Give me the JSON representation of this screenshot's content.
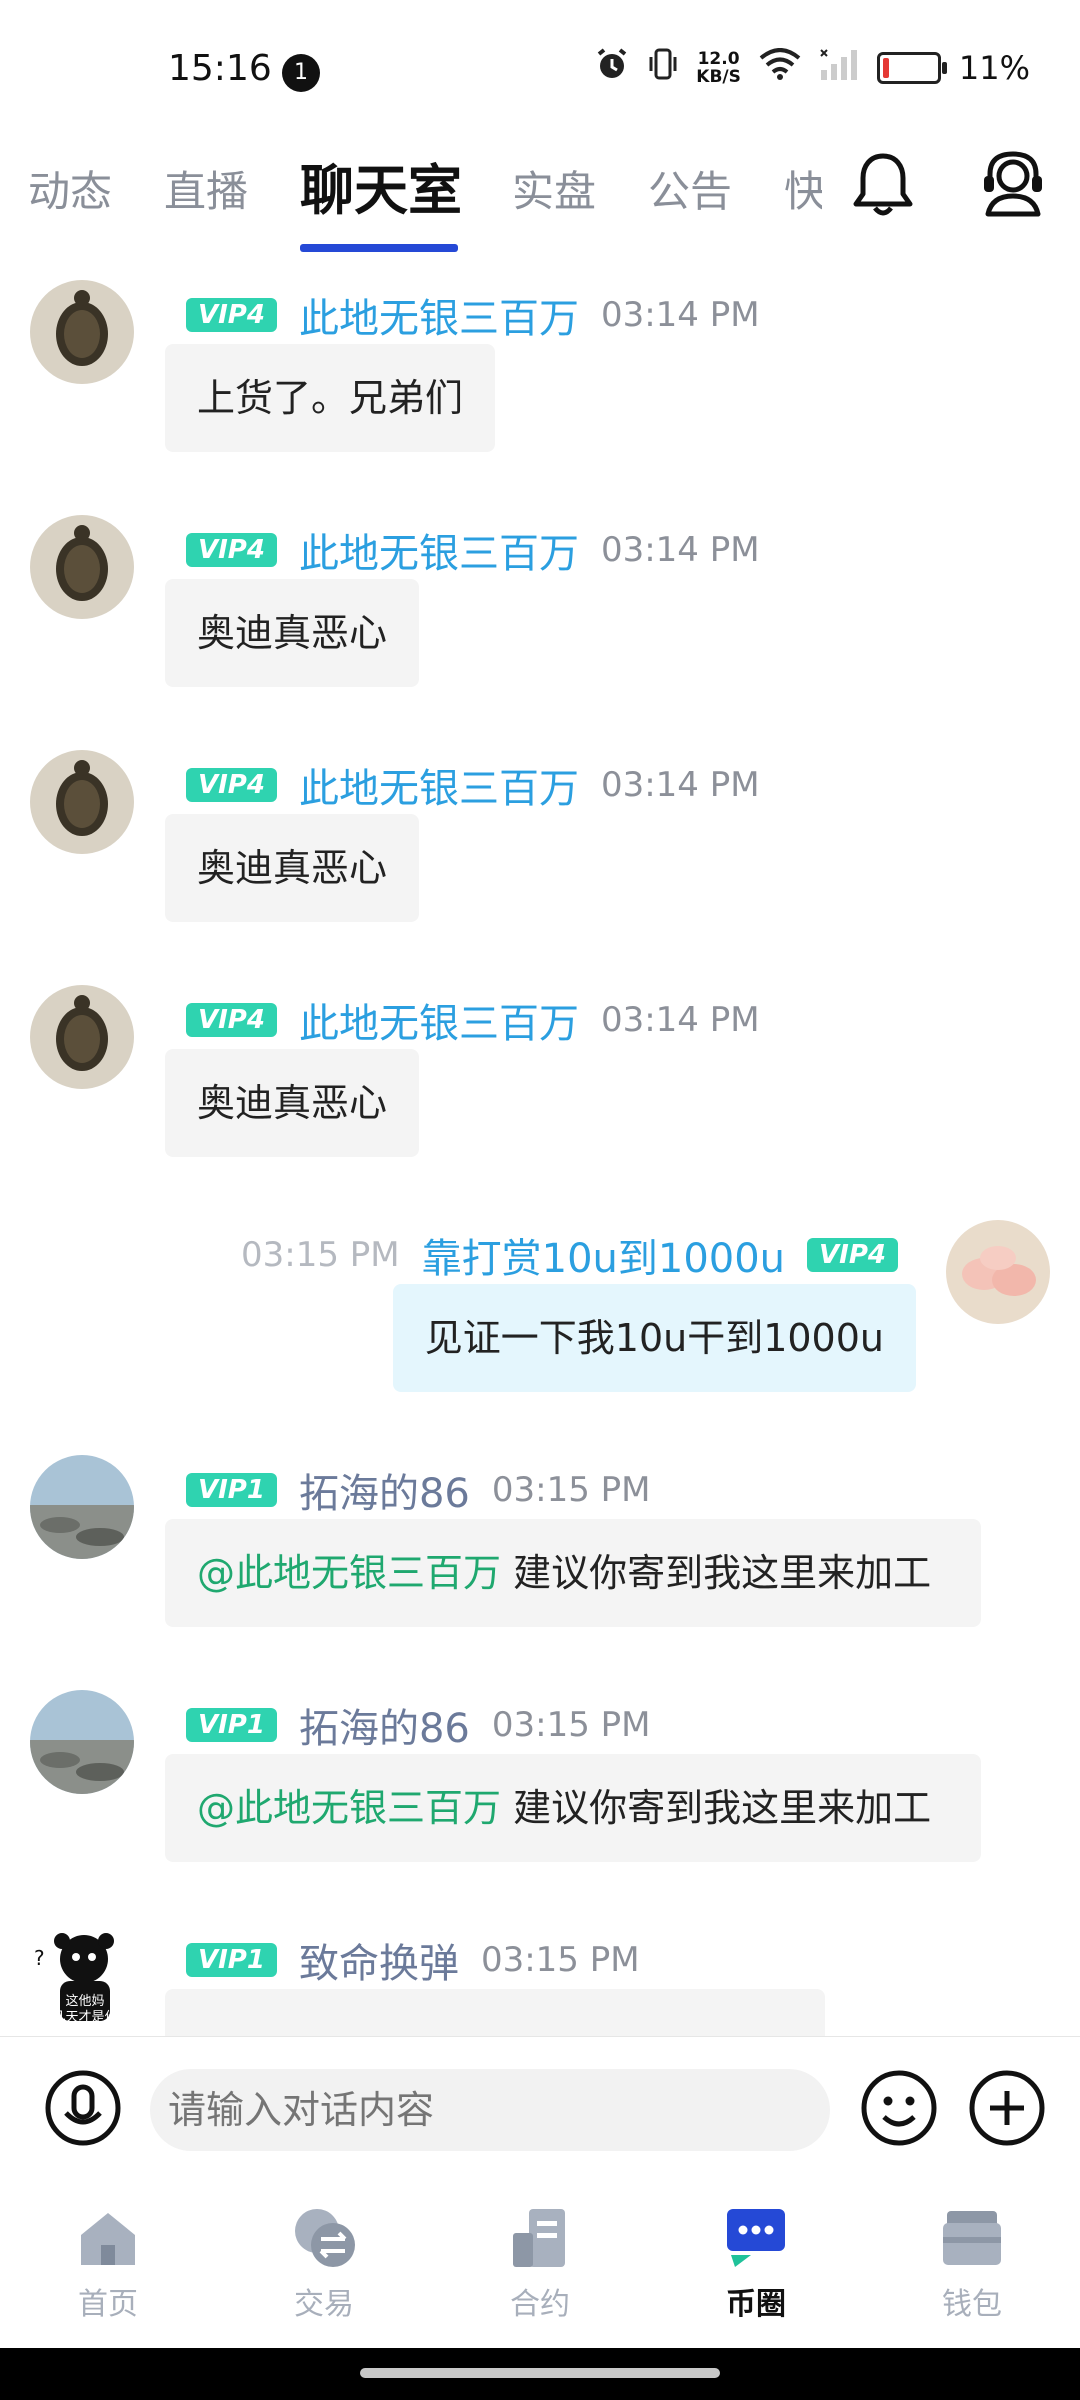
{
  "status_bar": {
    "time": "15:16",
    "notification_count": "1",
    "net_speed_value": "12.0",
    "net_speed_unit": "KB/S",
    "battery_percent": "11%",
    "battery_level": 0.11
  },
  "tabs": [
    {
      "label": "动态"
    },
    {
      "label": "直播"
    },
    {
      "label": "聊天室",
      "active": true
    },
    {
      "label": "实盘"
    },
    {
      "label": "公告"
    },
    {
      "label": "快"
    }
  ],
  "messages": [
    {
      "vip": "VIP4",
      "user": "此地无银三百万",
      "time": "03:14 PM",
      "text": "上货了。兄弟们"
    },
    {
      "vip": "VIP4",
      "user": "此地无银三百万",
      "time": "03:14 PM",
      "text": "奥迪真恶心"
    },
    {
      "vip": "VIP4",
      "user": "此地无银三百万",
      "time": "03:14 PM",
      "text": "奥迪真恶心"
    },
    {
      "vip": "VIP4",
      "user": "此地无银三百万",
      "time": "03:14 PM",
      "text": "奥迪真恶心"
    },
    {
      "vip": "VIP4",
      "user": "靠打赏10u到1000u",
      "time": "03:15 PM",
      "text": "见证一下我10u干到1000u",
      "mine": true
    },
    {
      "vip": "VIP1",
      "user": "拓海的86",
      "time": "03:15 PM",
      "mention": "@此地无银三百万",
      "text": " 建议你寄到我这里来加工"
    },
    {
      "vip": "VIP1",
      "user": "拓海的86",
      "time": "03:15 PM",
      "mention": "@此地无银三百万",
      "text": " 建议你寄到我这里来加工"
    },
    {
      "vip": "VIP1",
      "user": "致命换弹",
      "time": "03:15 PM",
      "text": ""
    }
  ],
  "avatar_texts": {
    "meme_line1": "这他妈",
    "meme_line2": "几天才是什"
  },
  "input": {
    "placeholder": "请输入对话内容"
  },
  "bottom_nav": [
    {
      "label": "首页",
      "icon": "home-icon"
    },
    {
      "label": "交易",
      "icon": "exchange-icon"
    },
    {
      "label": "合约",
      "icon": "contract-icon"
    },
    {
      "label": "币圈",
      "icon": "chat-bubble-icon",
      "active": true
    },
    {
      "label": "钱包",
      "icon": "wallet-icon"
    }
  ],
  "colors": {
    "accent_blue": "#2549d6",
    "vip_badge": "#2fd3b0",
    "username_blue": "#2b9fe0",
    "mention_green": "#1fa86f",
    "my_bubble": "#e4f6fd"
  }
}
